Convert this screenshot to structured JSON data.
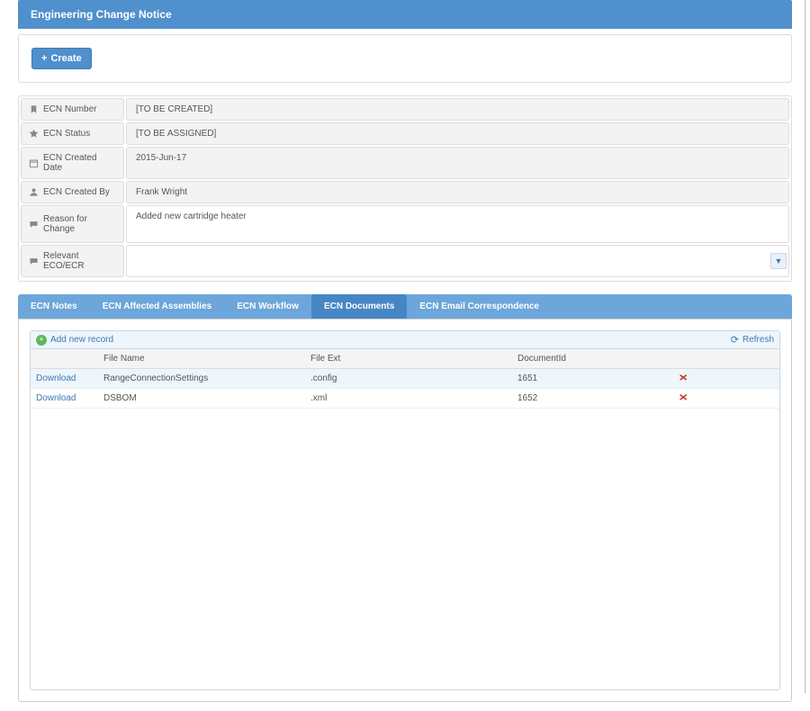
{
  "header": {
    "title": "Engineering Change Notice"
  },
  "toolbar": {
    "create_label": "Create"
  },
  "form": {
    "ecn_number_label": "ECN Number",
    "ecn_number_value": "[TO BE CREATED]",
    "ecn_status_label": "ECN Status",
    "ecn_status_value": "[TO BE ASSIGNED]",
    "ecn_created_date_label": "ECN Created Date",
    "ecn_created_date_value": "2015-Jun-17",
    "ecn_created_by_label": "ECN Created By",
    "ecn_created_by_value": "Frank Wright",
    "reason_label": "Reason for Change",
    "reason_value": "Added new cartridge heater",
    "relevant_eco_label": "Relevant ECO/ECR",
    "relevant_eco_value": ""
  },
  "tabs": [
    {
      "label": "ECN Notes",
      "active": false
    },
    {
      "label": "ECN Affected Assemblies",
      "active": false
    },
    {
      "label": "ECN Workflow",
      "active": false
    },
    {
      "label": "ECN Documents",
      "active": true
    },
    {
      "label": "ECN Email Correspondence",
      "active": false
    }
  ],
  "grid": {
    "add_label": "Add new record",
    "refresh_label": "Refresh",
    "download_label": "Download",
    "columns": {
      "file_name": "File Name",
      "file_ext": "File Ext",
      "document_id": "DocumentId"
    },
    "rows": [
      {
        "file_name": "RangeConnectionSettings",
        "file_ext": ".config",
        "document_id": "1651",
        "selected": true
      },
      {
        "file_name": "DSBOM",
        "file_ext": ".xml",
        "document_id": "1652",
        "selected": false
      }
    ]
  },
  "icons": {
    "bookmark": "bookmark-icon",
    "star": "star-icon",
    "calendar": "calendar-icon",
    "user": "user-icon",
    "comment": "comment-icon"
  }
}
